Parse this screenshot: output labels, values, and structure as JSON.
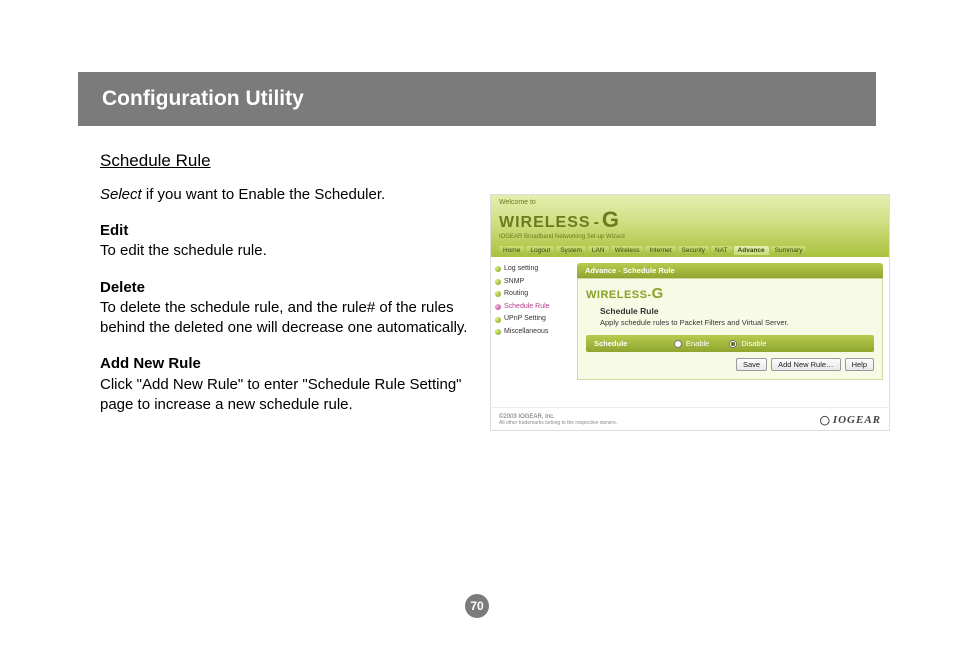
{
  "header": {
    "title": "Configuration Utility"
  },
  "section": {
    "title": "Schedule Rule"
  },
  "intro": {
    "select_word": "Select",
    "rest": " if you want to Enable the Scheduler."
  },
  "edit": {
    "heading": "Edit",
    "body": "To edit the schedule rule."
  },
  "delete": {
    "heading": "Delete",
    "body": "To delete the schedule rule, and the rule# of the rules behind the deleted one will decrease one automatically."
  },
  "addnew": {
    "heading": "Add New Rule",
    "body": "Click \"Add New Rule\" to enter \"Schedule Rule Setting\" page to increase a new schedule rule."
  },
  "page_number": "70",
  "screenshot": {
    "welcome": "Welcome to",
    "brand_main": "WIRELESS",
    "brand_dash": "-",
    "brand_g": "G",
    "brand_sub": "IOGEAR Broadband Networking Set-up Wizard",
    "nav": {
      "home": "Home",
      "logout": "Logout",
      "system": "System",
      "lan": "LAN",
      "wireless": "Wireless",
      "internet": "Internet",
      "security": "Security",
      "nat": "NAT",
      "advance": "Advance",
      "summary": "Summary"
    },
    "sidebar": {
      "log": "Log setting",
      "snmp": "SNMP",
      "routing": "Routing",
      "schedule": "Schedule Rule",
      "upnp": "UPnP Setting",
      "misc": "Miscellaneous"
    },
    "crumb": "Advance - Schedule Rule",
    "panel_brand_a": "WIRELESS",
    "panel_brand_dash": "-",
    "panel_brand_g": "G",
    "panel_title": "Schedule Rule",
    "panel_desc": "Apply schedule rules to Packet Filters and Virtual Server.",
    "sched_label": "Schedule",
    "enable": "Enable",
    "disable": "Disable",
    "btn_save": "Save",
    "btn_add": "Add New Rule…",
    "btn_help": "Help",
    "footer_copy": "©2003 IOGEAR, Inc.",
    "footer_small": "All other trademarks belong to the respective owners.",
    "footer_logo": "IOGEAR"
  }
}
